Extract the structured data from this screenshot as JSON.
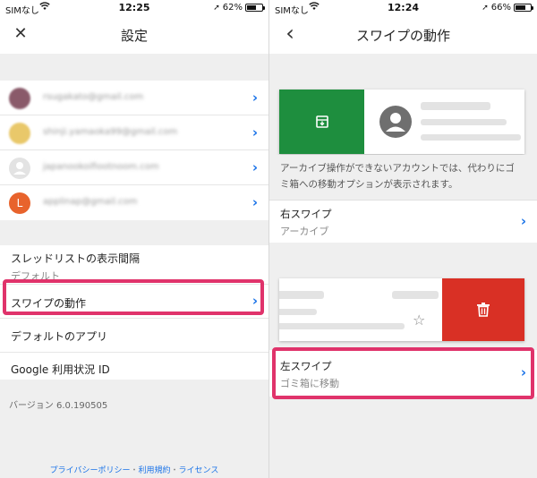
{
  "left_screen": {
    "status": {
      "carrier": "SIMなし",
      "time": "12:25",
      "battery": "62%",
      "battery_level": 0.62
    },
    "title": "設定",
    "close_icon": "close-icon",
    "accounts": [
      {
        "email": "rsugakato@gmail.com",
        "avatar_color": "#8a5a6a"
      },
      {
        "email": "shinji.yamaoka99@gmail.com",
        "avatar_color": "#e9c86a"
      },
      {
        "email": "japanookoifiootnoom.com",
        "avatar_color": "#e3e3e3"
      },
      {
        "email": "applinap@gmail.com",
        "avatar_color": "#e8632c",
        "avatar_letter": "L"
      }
    ],
    "settings": {
      "thread_density_label": "スレッドリストの表示間隔",
      "thread_density_value": "デフォルト",
      "swipe_label": "スワイプの動作",
      "default_apps_label": "デフォルトのアプリ",
      "google_usage_label": "Google 利用状況 ID"
    },
    "version": "バージョン 6.0.190505",
    "footer": {
      "privacy": "プライバシーポリシー",
      "terms": "利用規約",
      "licenses": "ライセンス",
      "sep": "・"
    }
  },
  "right_screen": {
    "status": {
      "carrier": "SIMなし",
      "time": "12:24",
      "battery": "66%",
      "battery_level": 0.66
    },
    "title": "スワイプの動作",
    "back_icon": "chevron-left-icon",
    "archive_note": "アーカイブ操作ができないアカウントでは、代わりにゴミ箱への移動オプションが表示されます。",
    "right_swipe": {
      "label": "右スワイプ",
      "value": "アーカイブ"
    },
    "left_swipe": {
      "label": "左スワイプ",
      "value": "ゴミ箱に移動"
    }
  },
  "colors": {
    "accent": "#1a73e8",
    "highlight": "#e0336b",
    "archive_green": "#1e8e3e",
    "delete_red": "#d93025",
    "section_gray": "#efefef"
  }
}
